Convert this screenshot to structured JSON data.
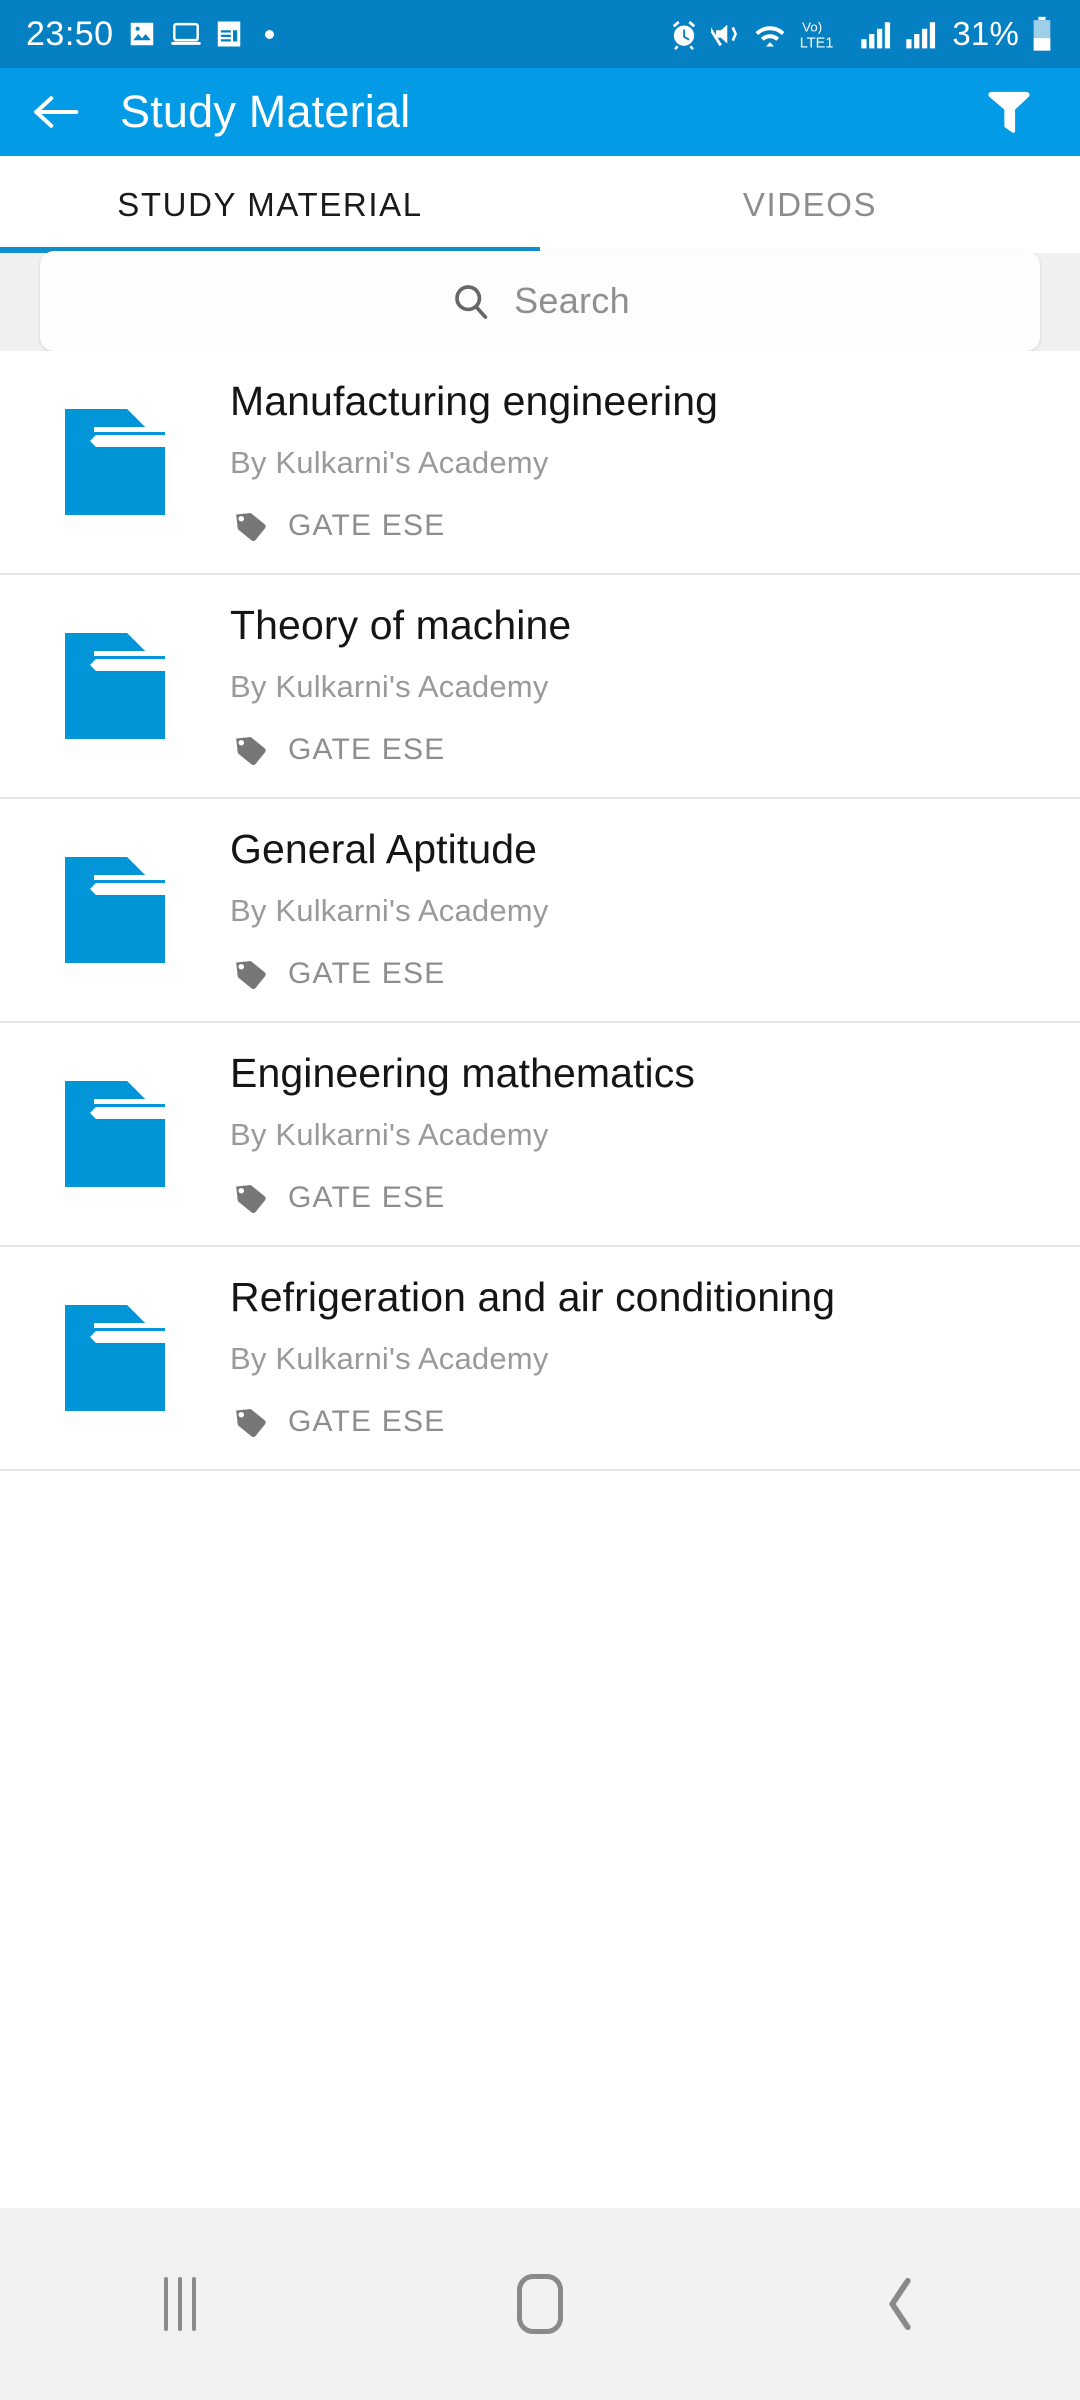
{
  "status_bar": {
    "time": "23:50",
    "battery_percent": "31%",
    "network_label": "LTE1",
    "volte_label": "Vo)",
    "icons": [
      "image-icon",
      "laptop-icon",
      "notes-icon",
      "dot-icon",
      "alarm-icon",
      "mute-vibrate-icon",
      "wifi-icon",
      "volte-icon",
      "signal-bars-icon",
      "signal-bars-icon-2",
      "battery-icon"
    ],
    "background_color": "#0580c2"
  },
  "app_bar": {
    "title": "Study Material",
    "back_icon": "arrow-left-icon",
    "filter_icon": "filter-funnel-icon",
    "background_color": "#039be5"
  },
  "tabs": {
    "items": [
      {
        "label": "STUDY MATERIAL",
        "active": true
      },
      {
        "label": "VIDEOS",
        "active": false
      }
    ],
    "indicator_color": "#0d8fd0"
  },
  "search": {
    "placeholder": "Search",
    "value": "",
    "icon": "search-icon"
  },
  "list": {
    "folder_color": "#0296d8",
    "items": [
      {
        "title": "Manufacturing engineering",
        "author": "By Kulkarni's Academy",
        "tag": "GATE ESE"
      },
      {
        "title": "Theory of machine",
        "author": "By Kulkarni's Academy",
        "tag": "GATE ESE"
      },
      {
        "title": "General Aptitude",
        "author": "By Kulkarni's Academy",
        "tag": "GATE ESE"
      },
      {
        "title": "Engineering mathematics",
        "author": "By Kulkarni's Academy",
        "tag": "GATE ESE"
      },
      {
        "title": "Refrigeration and air conditioning",
        "author": "By Kulkarni's Academy",
        "tag": "GATE ESE"
      }
    ]
  },
  "bottom_nav": {
    "items": [
      {
        "name": "recents-icon"
      },
      {
        "name": "home-icon"
      },
      {
        "name": "back-chevron-icon"
      }
    ],
    "background_color": "#f2f2f2"
  }
}
